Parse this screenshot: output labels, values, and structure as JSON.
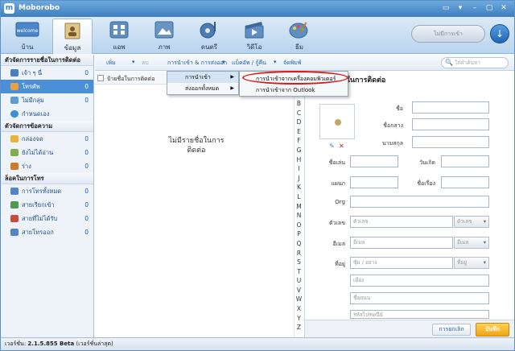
{
  "window": {
    "title": "Moborobo",
    "app_logo_letter": "m",
    "controls": [
      "▭",
      "▾",
      "–",
      "▢",
      "✕"
    ]
  },
  "toolbar": {
    "items": [
      {
        "label": "บ้าน",
        "icon": "home-icon",
        "badge": "welcome"
      },
      {
        "label": "ข้อมูล",
        "icon": "contacts-icon"
      },
      {
        "label": "แอพ",
        "icon": "apps-icon"
      },
      {
        "label": "ภาพ",
        "icon": "photos-icon"
      },
      {
        "label": "ดนตรี",
        "icon": "music-icon"
      },
      {
        "label": "วิดีโอ",
        "icon": "video-icon"
      },
      {
        "label": "ธีม",
        "icon": "themes-icon"
      }
    ],
    "search_text": "ไม่มีการเข้า",
    "download_icon": "↓",
    "active_index": 1
  },
  "sidebar": {
    "contacts_header": "ตัวจัดการรายชื่อในการติดต่อ",
    "contacts": [
      {
        "label": "เจ้า ๆ นี่",
        "count": "0",
        "color": "#4a7cc3"
      },
      {
        "label": "โทรศัพ",
        "count": "0",
        "color": "#e7a23b"
      },
      {
        "label": "ไม่มีกลุ่ม",
        "count": "0",
        "color": "#5d9bd6"
      },
      {
        "label": "กำหนดเอง",
        "count": "",
        "color": "#3a8fd8"
      }
    ],
    "messages_header": "ตัวจัดการข้อความ",
    "messages": [
      {
        "label": "กล่องจด",
        "count": "0",
        "color": "#e8b53a"
      },
      {
        "label": "ยังไม่ได้อ่าน",
        "count": "0",
        "color": "#7db04a"
      },
      {
        "label": "ร่าง",
        "count": "0",
        "color": "#d07b2a"
      }
    ],
    "calls_header": "ล็อคในการโทร",
    "calls": [
      {
        "label": "การโทรทั้งหมด",
        "count": "0",
        "color": "#4f86c6"
      },
      {
        "label": "สายเรียกเข้า",
        "count": "0",
        "color": "#4f9a4f"
      },
      {
        "label": "สายที่ไม่ได้รับ",
        "count": "0",
        "color": "#c84b3b"
      },
      {
        "label": "สายโทรออก",
        "count": "0",
        "color": "#4f86c6"
      }
    ]
  },
  "content_toolbar": {
    "add": "เพิ่ม",
    "delete": "ลบ",
    "import_export": "การนำเข้า & การส่งออก",
    "backup": "แบ็คอัพ / กู้คืน",
    "print": "จัดพิมพ์",
    "search_placeholder": "ใส่คำค้นหา",
    "search_icon": "🔍"
  },
  "list": {
    "header": "ป้ายชื่อในการติดต่อ",
    "empty_message": "ไม่มีรายชื่อในการติดต่อ"
  },
  "alphabet": [
    "B",
    "C",
    "D",
    "E",
    "F",
    "G",
    "H",
    "I",
    "J",
    "K",
    "L",
    "M",
    "N",
    "O",
    "P",
    "Q",
    "R",
    "S",
    "T",
    "U",
    "V",
    "W",
    "X",
    "Y",
    "Z"
  ],
  "detail": {
    "title": "ชื่อในการติดต่อ",
    "edit_icon": "✎",
    "delete_icon": "✕",
    "labels": {
      "first_name": "ชื่อ",
      "middle_name": "ชื่อกลาง",
      "last_name": "นามสกุล",
      "nickname": "ชื่อเล่น",
      "birthday": "วันเกิด",
      "department": "แผนก",
      "job_title": "ชื่อเรื่อง",
      "org": "Org",
      "phone": "ตัวเลข",
      "email": "อีเมล",
      "address": "ที่อยู่"
    },
    "placeholders": {
      "phone": "ตัวเลข",
      "email": "อีเมล",
      "street": "ซุ้ม / อย่าง",
      "city": "เมือง",
      "road": "ชื่อถนน",
      "postal": "รหัสไปรษณีย์"
    },
    "dropdowns": {
      "phone_type": "ตัวเลข",
      "email_type": "อีเมล",
      "address_type": "ที่อยู่"
    },
    "cancel_label": "การยกเลิก",
    "save_label": "บันทึก"
  },
  "menu_import": {
    "items": [
      {
        "label": "การนำเข้า"
      },
      {
        "label": "ส่งออกทั้งหมด"
      }
    ],
    "submenu": [
      {
        "label": "การนำเข้าจากเครื่องคอมพิวเตอร์"
      },
      {
        "label": "การนำเข้าจาก Outlook"
      }
    ]
  },
  "status": {
    "version_label": "เวอร์ชั่น:",
    "version": "2.1.5.855 Beta",
    "note": "(เวอร์ชั่นล่าสุด)"
  }
}
